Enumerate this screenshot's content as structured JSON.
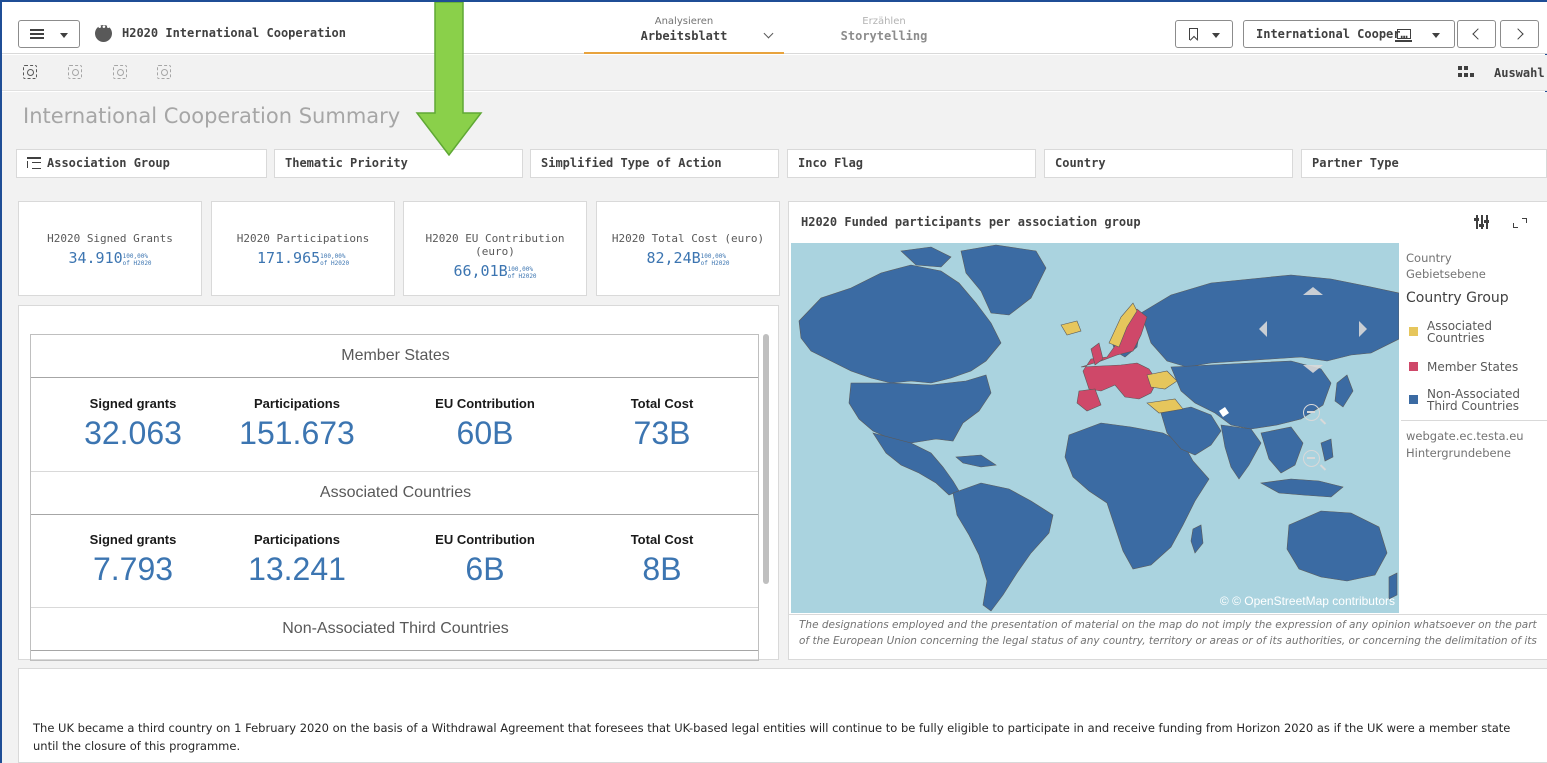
{
  "header": {
    "app_title": "H2020 International Cooperation",
    "tab_analyze": {
      "top": "Analysieren",
      "bottom": "Arbeitsblatt"
    },
    "tab_story": {
      "top": "Erzählen",
      "bottom": "Storytelling"
    },
    "sheet_selector": "International Cooper…"
  },
  "toolbar": {
    "selection_label": "Auswahl"
  },
  "sheet": {
    "title": "International Cooperation Summary",
    "filters": [
      "Association Group",
      "Thematic Priority",
      "Simplified Type of Action",
      "Inco Flag",
      "Country",
      "Partner Type"
    ]
  },
  "kpis": [
    {
      "label": "H2020 Signed Grants",
      "value": "34.910",
      "pct": "100,00%",
      "of": "of H2020"
    },
    {
      "label": "H2020 Participations",
      "value": "171.965",
      "pct": "100,00%",
      "of": "of H2020"
    },
    {
      "label": "H2020 EU Contribution (euro)",
      "value": "66,01B",
      "pct": "100,00%",
      "of": "of H2020"
    },
    {
      "label": "H2020 Total Cost (euro)",
      "value": "82,24B",
      "pct": "100,00%",
      "of": "of H2020"
    }
  ],
  "summary": {
    "metric_labels": [
      "Signed grants",
      "Participations",
      "EU Contribution",
      "Total Cost"
    ],
    "sections": [
      {
        "name": "Member States",
        "values": [
          "32.063",
          "151.673",
          "60B",
          "73B"
        ]
      },
      {
        "name": "Associated Countries",
        "values": [
          "7.793",
          "13.241",
          "6B",
          "8B"
        ]
      },
      {
        "name": "Non-Associated Third Countries"
      }
    ]
  },
  "map": {
    "title": "H2020 Funded participants per association group",
    "layer_name": "Country",
    "layer_type": "Gebietsebene",
    "legend_title": "Country Group",
    "legend": [
      {
        "label": "Associated Countries",
        "color": "#e6c65c"
      },
      {
        "label": "Member States",
        "color": "#cf4869"
      },
      {
        "label": "Non-Associated Third Countries",
        "color": "#3b6ba3"
      }
    ],
    "background_source": "webgate.ec.testa.eu",
    "background_type": "Hintergrundebene",
    "credit": "© © OpenStreetMap contributors",
    "ocean_color": "#aad3df",
    "disclaimer": "The designations employed and the presentation of material on the map do not imply the expression of any opinion whatsoever on the part of the European Union concerning the legal status of any country, territory or areas or of its authorities, or concerning the delimitation of its"
  },
  "note": {
    "text": "The UK became a third country on 1 February 2020 on the basis of a Withdrawal Agreement that foresees that UK-based legal entities will continue to be fully eligible to participate in and receive funding from Horizon 2020 as if the UK were a member state until the closure of this programme."
  },
  "annotation": {
    "arrow_color": "#8ad04a"
  }
}
